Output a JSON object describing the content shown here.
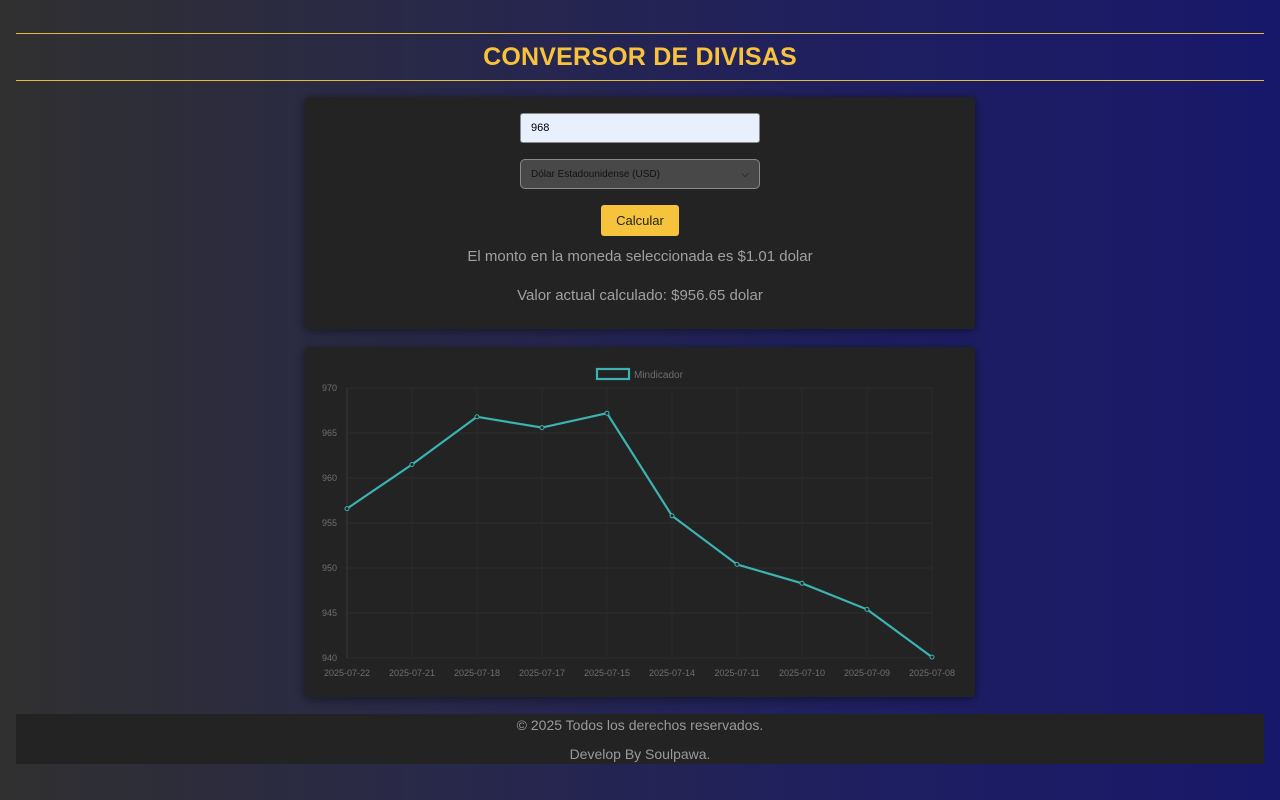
{
  "header": {
    "title": "CONVERSOR DE DIVISAS"
  },
  "converter": {
    "amount_value": "968",
    "currency_selected": "Dólar Estadounidense (USD)",
    "calculate_label": "Calcular",
    "result_rate": "El monto en la moneda seleccionada es $1.01 dolar",
    "result_value": "Valor actual calculado: $956.65 dolar"
  },
  "chart_data": {
    "type": "line",
    "categories": [
      "2025-07-22",
      "2025-07-21",
      "2025-07-18",
      "2025-07-17",
      "2025-07-15",
      "2025-07-14",
      "2025-07-11",
      "2025-07-10",
      "2025-07-09",
      "2025-07-08"
    ],
    "series": [
      {
        "name": "Mindicador",
        "values": [
          956.6,
          961.5,
          966.8,
          965.6,
          967.2,
          955.8,
          950.4,
          948.3,
          945.4,
          940.1
        ],
        "color": "#3bb3b0"
      }
    ],
    "yticks": [
      940,
      945,
      950,
      955,
      960,
      965,
      970
    ],
    "ylim": [
      940,
      970
    ],
    "grid": true,
    "legend": "top-center"
  },
  "footer": {
    "copyright": "© 2025 Todos los derechos reservados.",
    "credit": "Develop By Soulpawa."
  }
}
